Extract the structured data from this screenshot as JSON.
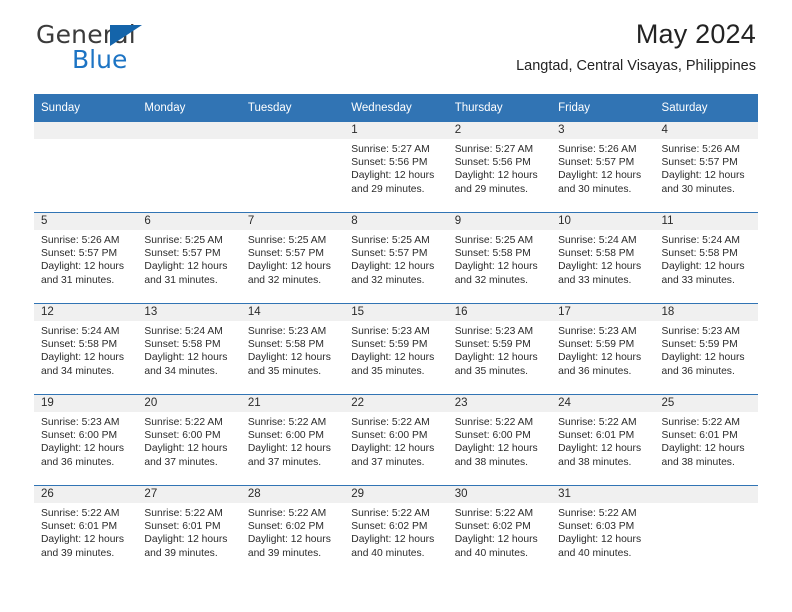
{
  "brand": {
    "name_top": "General",
    "name_bottom": "Blue",
    "accent_color": "#1d74c4"
  },
  "header": {
    "title": "May 2024",
    "subtitle": "Langtad, Central Visayas, Philippines"
  },
  "calendar": {
    "header_bg": "#3174b4",
    "daynum_bg": "#f0f0f0",
    "weekday_headers": [
      "Sunday",
      "Monday",
      "Tuesday",
      "Wednesday",
      "Thursday",
      "Friday",
      "Saturday"
    ],
    "weeks": [
      [
        {
          "day": "",
          "empty": true
        },
        {
          "day": "",
          "empty": true
        },
        {
          "day": "",
          "empty": true
        },
        {
          "day": "1",
          "sunrise": "Sunrise: 5:27 AM",
          "sunset": "Sunset: 5:56 PM",
          "daylight1": "Daylight: 12 hours",
          "daylight2": "and 29 minutes."
        },
        {
          "day": "2",
          "sunrise": "Sunrise: 5:27 AM",
          "sunset": "Sunset: 5:56 PM",
          "daylight1": "Daylight: 12 hours",
          "daylight2": "and 29 minutes."
        },
        {
          "day": "3",
          "sunrise": "Sunrise: 5:26 AM",
          "sunset": "Sunset: 5:57 PM",
          "daylight1": "Daylight: 12 hours",
          "daylight2": "and 30 minutes."
        },
        {
          "day": "4",
          "sunrise": "Sunrise: 5:26 AM",
          "sunset": "Sunset: 5:57 PM",
          "daylight1": "Daylight: 12 hours",
          "daylight2": "and 30 minutes."
        }
      ],
      [
        {
          "day": "5",
          "sunrise": "Sunrise: 5:26 AM",
          "sunset": "Sunset: 5:57 PM",
          "daylight1": "Daylight: 12 hours",
          "daylight2": "and 31 minutes."
        },
        {
          "day": "6",
          "sunrise": "Sunrise: 5:25 AM",
          "sunset": "Sunset: 5:57 PM",
          "daylight1": "Daylight: 12 hours",
          "daylight2": "and 31 minutes."
        },
        {
          "day": "7",
          "sunrise": "Sunrise: 5:25 AM",
          "sunset": "Sunset: 5:57 PM",
          "daylight1": "Daylight: 12 hours",
          "daylight2": "and 32 minutes."
        },
        {
          "day": "8",
          "sunrise": "Sunrise: 5:25 AM",
          "sunset": "Sunset: 5:57 PM",
          "daylight1": "Daylight: 12 hours",
          "daylight2": "and 32 minutes."
        },
        {
          "day": "9",
          "sunrise": "Sunrise: 5:25 AM",
          "sunset": "Sunset: 5:58 PM",
          "daylight1": "Daylight: 12 hours",
          "daylight2": "and 32 minutes."
        },
        {
          "day": "10",
          "sunrise": "Sunrise: 5:24 AM",
          "sunset": "Sunset: 5:58 PM",
          "daylight1": "Daylight: 12 hours",
          "daylight2": "and 33 minutes."
        },
        {
          "day": "11",
          "sunrise": "Sunrise: 5:24 AM",
          "sunset": "Sunset: 5:58 PM",
          "daylight1": "Daylight: 12 hours",
          "daylight2": "and 33 minutes."
        }
      ],
      [
        {
          "day": "12",
          "sunrise": "Sunrise: 5:24 AM",
          "sunset": "Sunset: 5:58 PM",
          "daylight1": "Daylight: 12 hours",
          "daylight2": "and 34 minutes."
        },
        {
          "day": "13",
          "sunrise": "Sunrise: 5:24 AM",
          "sunset": "Sunset: 5:58 PM",
          "daylight1": "Daylight: 12 hours",
          "daylight2": "and 34 minutes."
        },
        {
          "day": "14",
          "sunrise": "Sunrise: 5:23 AM",
          "sunset": "Sunset: 5:58 PM",
          "daylight1": "Daylight: 12 hours",
          "daylight2": "and 35 minutes."
        },
        {
          "day": "15",
          "sunrise": "Sunrise: 5:23 AM",
          "sunset": "Sunset: 5:59 PM",
          "daylight1": "Daylight: 12 hours",
          "daylight2": "and 35 minutes."
        },
        {
          "day": "16",
          "sunrise": "Sunrise: 5:23 AM",
          "sunset": "Sunset: 5:59 PM",
          "daylight1": "Daylight: 12 hours",
          "daylight2": "and 35 minutes."
        },
        {
          "day": "17",
          "sunrise": "Sunrise: 5:23 AM",
          "sunset": "Sunset: 5:59 PM",
          "daylight1": "Daylight: 12 hours",
          "daylight2": "and 36 minutes."
        },
        {
          "day": "18",
          "sunrise": "Sunrise: 5:23 AM",
          "sunset": "Sunset: 5:59 PM",
          "daylight1": "Daylight: 12 hours",
          "daylight2": "and 36 minutes."
        }
      ],
      [
        {
          "day": "19",
          "sunrise": "Sunrise: 5:23 AM",
          "sunset": "Sunset: 6:00 PM",
          "daylight1": "Daylight: 12 hours",
          "daylight2": "and 36 minutes."
        },
        {
          "day": "20",
          "sunrise": "Sunrise: 5:22 AM",
          "sunset": "Sunset: 6:00 PM",
          "daylight1": "Daylight: 12 hours",
          "daylight2": "and 37 minutes."
        },
        {
          "day": "21",
          "sunrise": "Sunrise: 5:22 AM",
          "sunset": "Sunset: 6:00 PM",
          "daylight1": "Daylight: 12 hours",
          "daylight2": "and 37 minutes."
        },
        {
          "day": "22",
          "sunrise": "Sunrise: 5:22 AM",
          "sunset": "Sunset: 6:00 PM",
          "daylight1": "Daylight: 12 hours",
          "daylight2": "and 37 minutes."
        },
        {
          "day": "23",
          "sunrise": "Sunrise: 5:22 AM",
          "sunset": "Sunset: 6:00 PM",
          "daylight1": "Daylight: 12 hours",
          "daylight2": "and 38 minutes."
        },
        {
          "day": "24",
          "sunrise": "Sunrise: 5:22 AM",
          "sunset": "Sunset: 6:01 PM",
          "daylight1": "Daylight: 12 hours",
          "daylight2": "and 38 minutes."
        },
        {
          "day": "25",
          "sunrise": "Sunrise: 5:22 AM",
          "sunset": "Sunset: 6:01 PM",
          "daylight1": "Daylight: 12 hours",
          "daylight2": "and 38 minutes."
        }
      ],
      [
        {
          "day": "26",
          "sunrise": "Sunrise: 5:22 AM",
          "sunset": "Sunset: 6:01 PM",
          "daylight1": "Daylight: 12 hours",
          "daylight2": "and 39 minutes."
        },
        {
          "day": "27",
          "sunrise": "Sunrise: 5:22 AM",
          "sunset": "Sunset: 6:01 PM",
          "daylight1": "Daylight: 12 hours",
          "daylight2": "and 39 minutes."
        },
        {
          "day": "28",
          "sunrise": "Sunrise: 5:22 AM",
          "sunset": "Sunset: 6:02 PM",
          "daylight1": "Daylight: 12 hours",
          "daylight2": "and 39 minutes."
        },
        {
          "day": "29",
          "sunrise": "Sunrise: 5:22 AM",
          "sunset": "Sunset: 6:02 PM",
          "daylight1": "Daylight: 12 hours",
          "daylight2": "and 40 minutes."
        },
        {
          "day": "30",
          "sunrise": "Sunrise: 5:22 AM",
          "sunset": "Sunset: 6:02 PM",
          "daylight1": "Daylight: 12 hours",
          "daylight2": "and 40 minutes."
        },
        {
          "day": "31",
          "sunrise": "Sunrise: 5:22 AM",
          "sunset": "Sunset: 6:03 PM",
          "daylight1": "Daylight: 12 hours",
          "daylight2": "and 40 minutes."
        },
        {
          "day": "",
          "empty": true
        }
      ]
    ]
  }
}
